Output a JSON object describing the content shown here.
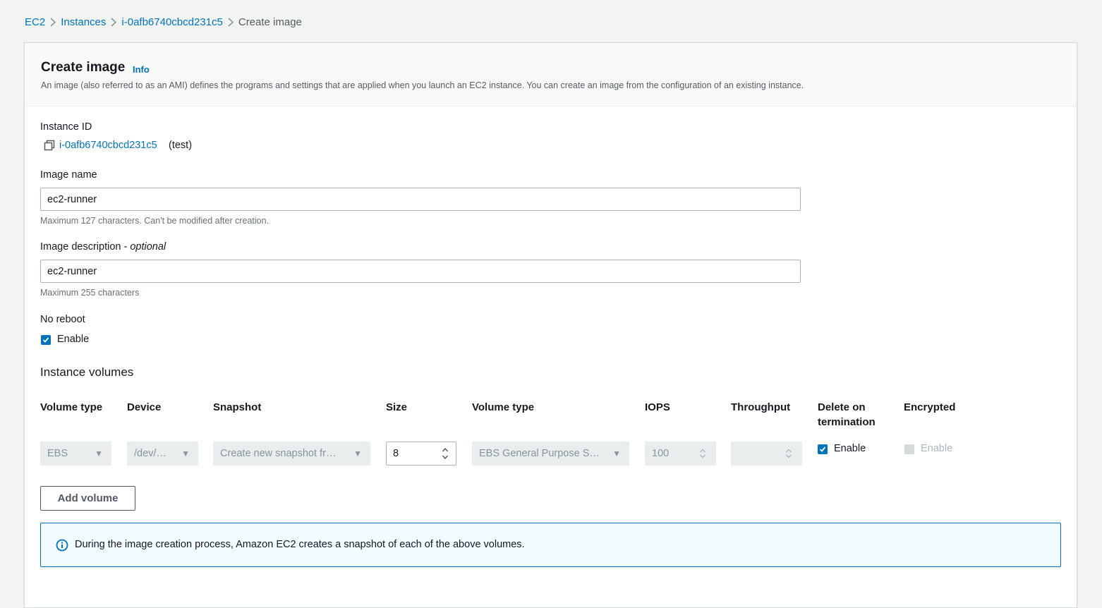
{
  "breadcrumb": {
    "items": [
      "EC2",
      "Instances",
      "i-0afb6740cbcd231c5"
    ],
    "current": "Create image"
  },
  "header": {
    "title": "Create image",
    "info_label": "Info",
    "description": "An image (also referred to as an AMI) defines the programs and settings that are applied when you launch an EC2 instance. You can create an image from the configuration of an existing instance."
  },
  "instance": {
    "label": "Instance ID",
    "id": "i-0afb6740cbcd231c5",
    "name": "(test)",
    "copy_icon": "copy-icon"
  },
  "image_name": {
    "label": "Image name",
    "value": "ec2-runner",
    "hint": "Maximum 127 characters. Can't be modified after creation."
  },
  "image_description": {
    "label": "Image description - ",
    "label_optional": "optional",
    "value": "ec2-runner",
    "hint": "Maximum 255 characters"
  },
  "no_reboot": {
    "label": "No reboot",
    "checkbox_label": "Enable",
    "checked": true
  },
  "volumes": {
    "title": "Instance volumes",
    "columns": [
      "Volume type",
      "Device",
      "Snapshot",
      "Size",
      "Volume type",
      "IOPS",
      "Throughput",
      "Delete on termination",
      "Encrypted"
    ],
    "row": {
      "volume_type": "EBS",
      "device": "/dev/…",
      "snapshot": "Create new snapshot fr…",
      "size": "8",
      "ebs_type": "EBS General Purpose S…",
      "iops": "100",
      "throughput": "",
      "delete_on_termination_label": "Enable",
      "delete_on_termination": true,
      "encrypted_label": "Enable",
      "encrypted": false
    },
    "add_button": "Add volume"
  },
  "alert": {
    "icon": "info-icon",
    "text": "During the image creation process, Amazon EC2 creates a snapshot of each of the above volumes."
  },
  "colors": {
    "link": "#0073bb",
    "page_bg": "#f2f3f3",
    "alert_bg": "#f1faff"
  }
}
